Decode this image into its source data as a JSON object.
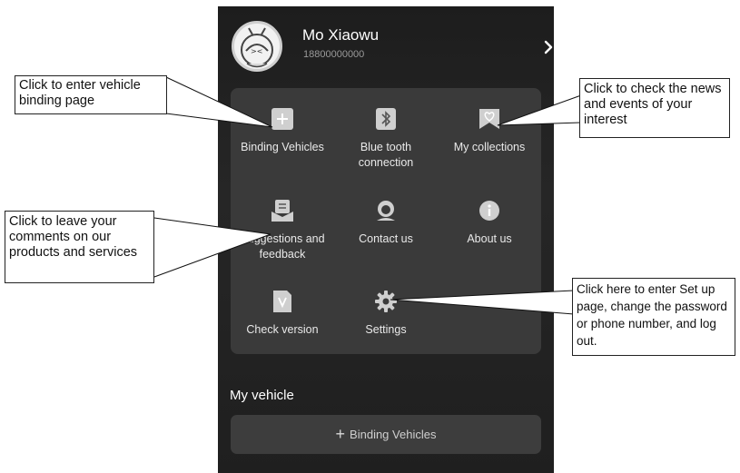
{
  "profile": {
    "name": "Mo Xiaowu",
    "phone": "18800000000"
  },
  "menu": [
    {
      "label": "Binding Vehicles",
      "icon": "binding-plus-icon"
    },
    {
      "label": "Blue tooth connection",
      "icon": "bluetooth-icon"
    },
    {
      "label": "My collections",
      "icon": "collections-heart-icon"
    },
    {
      "label": "Suggestions and feedback",
      "icon": "feedback-icon"
    },
    {
      "label": "Contact us",
      "icon": "headset-icon"
    },
    {
      "label": "About us",
      "icon": "info-icon"
    },
    {
      "label": "Check version",
      "icon": "version-icon"
    },
    {
      "label": "Settings",
      "icon": "gear-icon"
    }
  ],
  "my_vehicle": {
    "title": "My vehicle",
    "button_label": "Binding Vehicles"
  },
  "annotations": {
    "binding": "Click to enter vehicle binding page",
    "collections": "Click to check the news and events of your interest",
    "feedback": "Click to leave your comments on our products and services",
    "settings": "Click here to enter Set up page, change the password or phone number, and log out."
  },
  "colors": {
    "panel": "#222222",
    "card": "#3a3a3a",
    "text": "#e9e9e9"
  }
}
